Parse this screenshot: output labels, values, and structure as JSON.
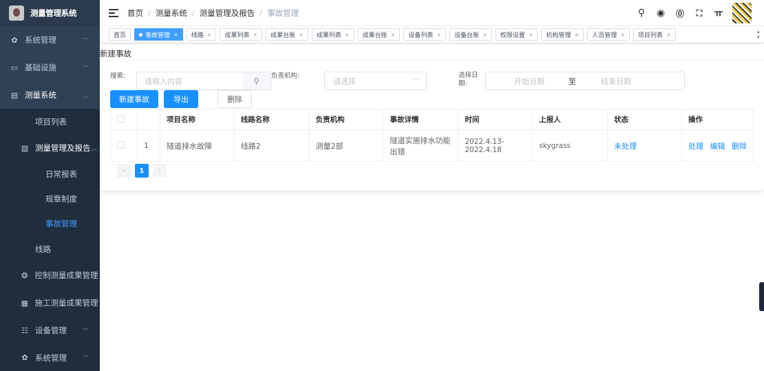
{
  "app": {
    "title": "测量管理系统"
  },
  "sidebar": {
    "items": [
      {
        "label": "系统管理",
        "icon": "gear-icon"
      },
      {
        "label": "基础设施",
        "icon": "monitor-icon"
      },
      {
        "label": "测量系统",
        "icon": "document-icon"
      },
      {
        "label": "项目列表"
      },
      {
        "label": "测量管理及报告",
        "icon": "copy-icon"
      },
      {
        "label": "日常报表"
      },
      {
        "label": "规章制度"
      },
      {
        "label": "事故管理"
      },
      {
        "label": "线路"
      },
      {
        "label": "控制测量成果管理",
        "icon": "users-icon"
      },
      {
        "label": "施工测量成果管理",
        "icon": "clipboard-icon"
      },
      {
        "label": "设备管理",
        "icon": "sliders-icon"
      },
      {
        "label": "系统管理",
        "icon": "gear-icon"
      }
    ]
  },
  "header": {
    "breadcrumb": [
      "首页",
      "测量系统",
      "测量管理及报告",
      "事故管理"
    ],
    "tools": [
      "search-icon",
      "github-icon",
      "help-icon",
      "fullscreen-icon",
      "font-size-icon",
      "avatar"
    ]
  },
  "tags": [
    "首页",
    "事故管理",
    "线路",
    "成果列表",
    "成果台账",
    "成果列表",
    "成果台账",
    "设备列表",
    "设备台账",
    "权限设置",
    "机构管理",
    "人员管理",
    "项目列表"
  ],
  "main": {
    "page_label": "新建事故",
    "filters": {
      "search_label": "搜索:",
      "search_placeholder": "请输入内容",
      "org_label": "负责机构:",
      "org_placeholder": "请选择",
      "date_label": "选择日期:",
      "date_start": "开始日期",
      "date_sep": "至",
      "date_end": "结束日期"
    },
    "buttons": {
      "create": "新建事故",
      "export": "导出",
      "delete": "删除"
    },
    "table": {
      "headers": [
        "项目名称",
        "线路名称",
        "负责机构",
        "事故详情",
        "时间",
        "上报人",
        "状态",
        "操作"
      ],
      "rows": [
        {
          "index": "1",
          "project": "隧道排水故障",
          "line": "线路2",
          "org": "测量2部",
          "detail": "隧道实施排水功能出错",
          "time": "2022.4.13-2022.4.18",
          "reporter": "skygrass",
          "status": "未处理",
          "actions": [
            "处理",
            "编辑",
            "删除"
          ]
        }
      ]
    },
    "pagination": {
      "prev": "‹",
      "current": "1",
      "next": "›"
    }
  },
  "colors": {
    "sidebar_bg": "#304156",
    "primary": "#1890ff",
    "active_menu": "#409eff"
  }
}
